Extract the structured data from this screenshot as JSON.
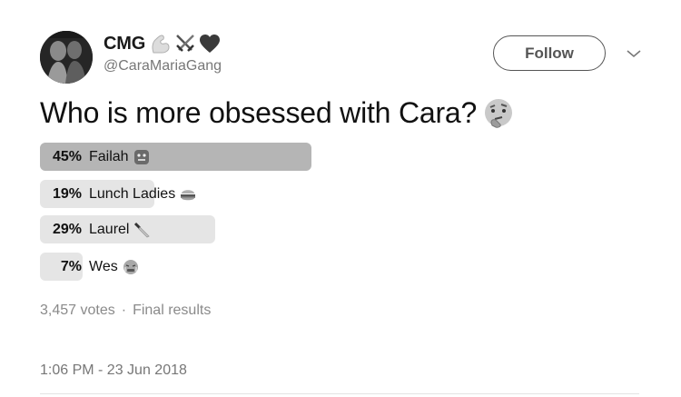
{
  "tweet": {
    "author": {
      "display_name": "CMG",
      "name_emoji": [
        "flexed-biceps-icon",
        "crossed-swords-icon",
        "heart-icon"
      ],
      "handle": "@CaraMariaGang"
    },
    "follow_label": "Follow",
    "text": "Who is more obsessed with Cara?",
    "text_emoji": "thinking-face-icon",
    "poll": {
      "options": [
        {
          "percent": "45%",
          "label": "Failah",
          "emoji": "face-icon",
          "fraction": 0.45,
          "winner": true
        },
        {
          "percent": "19%",
          "label": "Lunch Ladies",
          "emoji": "hamburger-icon",
          "fraction": 0.19,
          "winner": false
        },
        {
          "percent": "29%",
          "label": "Laurel",
          "emoji": "knife-icon",
          "fraction": 0.29,
          "winner": false
        },
        {
          "percent": "7%",
          "label": "Wes",
          "emoji": "crying-face-icon",
          "fraction": 0.07,
          "winner": false
        }
      ],
      "votes": "3,457 votes",
      "separator": "·",
      "status": "Final results"
    },
    "timestamp": "1:06 PM - 23 Jun 2018"
  }
}
